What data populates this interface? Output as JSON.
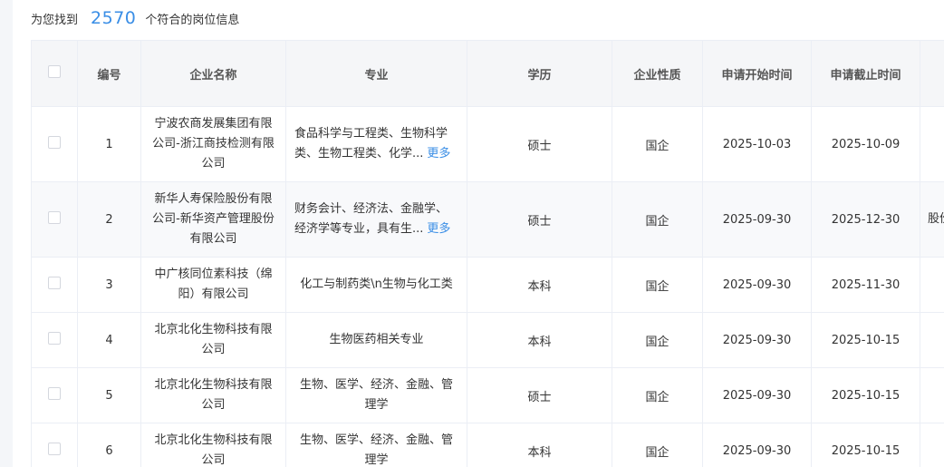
{
  "summary": {
    "prefix": "为您找到",
    "count": "2570",
    "suffix": "个符合的岗位信息"
  },
  "table": {
    "headers": {
      "index": "编号",
      "company": "企业名称",
      "major": "专业",
      "degree": "学历",
      "nature": "企业性质",
      "start": "申请开始时间",
      "end": "申请截止时间"
    },
    "more_label": "更多",
    "rows": [
      {
        "index": "1",
        "company": "宁波农商发展集团有限公司-浙江商技检测有限公司",
        "major": "食品科学与工程类、生物科学类、生物工程类、化学...",
        "has_more": true,
        "degree": "硕士",
        "nature": "国企",
        "start": "2025-10-03",
        "end": "2025-10-09",
        "extra": ""
      },
      {
        "index": "2",
        "company": "新华人寿保险股份有限公司-新华资产管理股份有限公司",
        "major": "财务会计、经济法、金融学、经济学等专业，具有生...",
        "has_more": true,
        "degree": "硕士",
        "nature": "国企",
        "start": "2025-09-30",
        "end": "2025-12-30",
        "extra": "股份部"
      },
      {
        "index": "3",
        "company": "中广核同位素科技（绵阳）有限公司",
        "major": "化工与制药类\\n生物与化工类",
        "has_more": false,
        "degree": "本科",
        "nature": "国企",
        "start": "2025-09-30",
        "end": "2025-11-30",
        "extra": ""
      },
      {
        "index": "4",
        "company": "北京北化生物科技有限公司",
        "major": "生物医药相关专业",
        "has_more": false,
        "degree": "本科",
        "nature": "国企",
        "start": "2025-09-30",
        "end": "2025-10-15",
        "extra": ""
      },
      {
        "index": "5",
        "company": "北京北化生物科技有限公司",
        "major": "生物、医学、经济、金融、管理学",
        "has_more": false,
        "degree": "硕士",
        "nature": "国企",
        "start": "2025-09-30",
        "end": "2025-10-15",
        "extra": ""
      },
      {
        "index": "6",
        "company": "北京北化生物科技有限公司",
        "major": "生物、医学、经济、金融、管理学",
        "has_more": false,
        "degree": "本科",
        "nature": "国企",
        "start": "2025-09-30",
        "end": "2025-10-15",
        "extra": ""
      }
    ]
  }
}
